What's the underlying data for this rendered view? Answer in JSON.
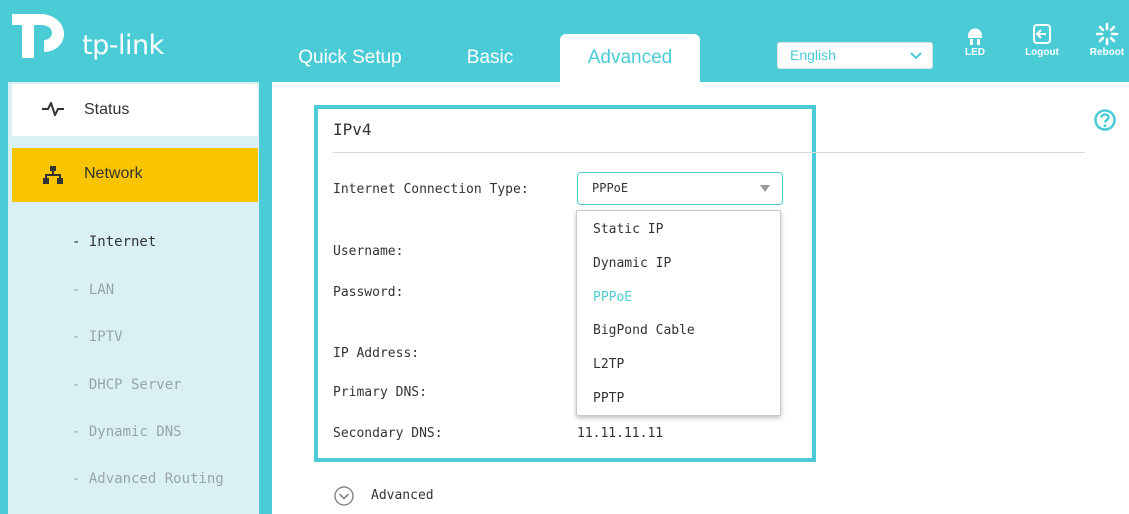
{
  "brand": {
    "name": "tp-link",
    "color": "#4acbd6",
    "accent": "#f8c500"
  },
  "nav": {
    "tabs": [
      {
        "label": "Quick Setup"
      },
      {
        "label": "Basic"
      },
      {
        "label": "Advanced",
        "active": true
      }
    ],
    "language": {
      "selected": "English"
    },
    "buttons": [
      {
        "label": "LED",
        "icon": "led-icon"
      },
      {
        "label": "Logout",
        "icon": "logout-icon"
      },
      {
        "label": "Reboot",
        "icon": "reboot-icon"
      }
    ]
  },
  "sidebar": {
    "status": {
      "label": "Status",
      "icon": "pulse-icon"
    },
    "network": {
      "label": "Network",
      "icon": "network-icon"
    },
    "items": [
      {
        "label": "- Internet",
        "active": true
      },
      {
        "label": "- LAN"
      },
      {
        "label": "- IPTV"
      },
      {
        "label": "- DHCP Server"
      },
      {
        "label": "- Dynamic DNS"
      },
      {
        "label": "- Advanced Routing"
      }
    ]
  },
  "ipv4": {
    "title": "IPv4",
    "connection_type_label": "Internet Connection Type:",
    "connection_type_value": "PPPoE",
    "options": [
      "Static IP",
      "Dynamic IP",
      "PPPoE",
      "BigPond Cable",
      "L2TP",
      "PPTP"
    ],
    "selected_option": "PPPoE",
    "username_label": "Username:",
    "password_label": "Password:",
    "ip_address_label": "IP Address:",
    "primary_dns_label": "Primary DNS:",
    "secondary_dns_label": "Secondary DNS:",
    "secondary_dns_value": "11.11.11.11"
  },
  "advanced_toggle": {
    "label": "Advanced"
  }
}
